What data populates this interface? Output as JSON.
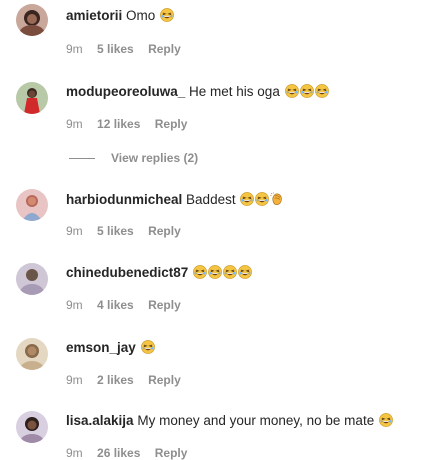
{
  "comments": [
    {
      "username": "amietorii",
      "text": "Omo",
      "emojis": [
        "laughing-emoji"
      ],
      "time": "9m",
      "likes": "5 likes",
      "reply": "Reply"
    },
    {
      "username": "modupeoreoluwa_",
      "text": "He met his oga",
      "emojis": [
        "laughing-emoji",
        "laughing-emoji",
        "laughing-emoji"
      ],
      "time": "9m",
      "likes": "12 likes",
      "reply": "Reply",
      "view_replies": "View replies (2)"
    },
    {
      "username": "harbiodunmicheal",
      "text": "Baddest",
      "emojis": [
        "laughing-emoji",
        "laughing-emoji",
        "clapping-hands-emoji"
      ],
      "time": "9m",
      "likes": "5 likes",
      "reply": "Reply"
    },
    {
      "username": "chinedubenedict87",
      "text": "",
      "emojis": [
        "laughing-emoji",
        "laughing-emoji",
        "laughing-emoji",
        "laughing-emoji"
      ],
      "time": "9m",
      "likes": "4 likes",
      "reply": "Reply"
    },
    {
      "username": "emson_jay",
      "text": "",
      "emojis": [
        "laughing-emoji"
      ],
      "time": "9m",
      "likes": "2 likes",
      "reply": "Reply"
    },
    {
      "username": "lisa.alakija",
      "text": "My money and your money, no be mate",
      "emojis": [
        "laughing-emoji"
      ],
      "time": "9m",
      "likes": "26 likes",
      "reply": "Reply"
    }
  ],
  "colors": {
    "username": "#262626",
    "meta": "#8e8e8e",
    "background": "#ffffff"
  }
}
